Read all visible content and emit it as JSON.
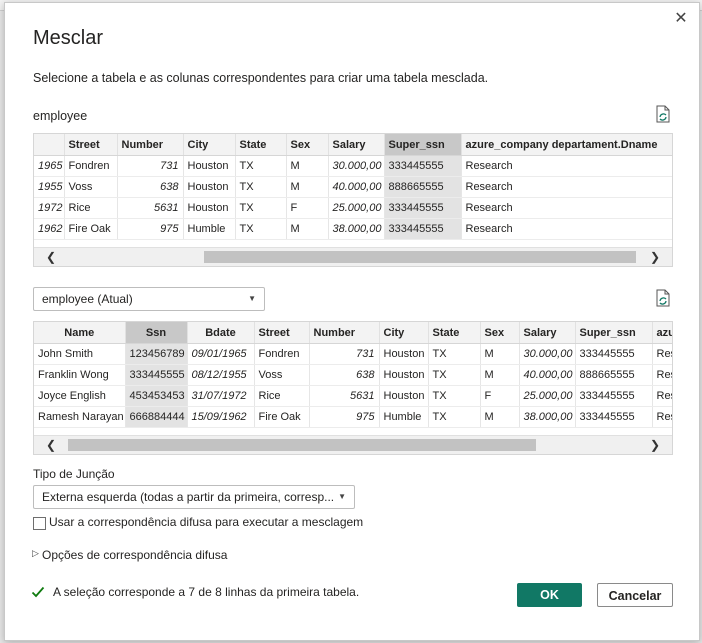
{
  "dialog": {
    "title": "Mesclar",
    "description": "Selecione a tabela e as colunas correspondentes para criar uma tabela mesclada.",
    "close_icon": "close-icon"
  },
  "first_table": {
    "name": "employee",
    "columns": [
      "",
      "Street",
      "Number",
      "City",
      "State",
      "Sex",
      "Salary",
      "Super_ssn",
      "azure_company departament.Dname"
    ],
    "rows": [
      [
        "1965",
        "Fondren",
        "731",
        "Houston",
        "TX",
        "M",
        "30.000,00",
        "333445555",
        "Research"
      ],
      [
        "1955",
        "Voss",
        "638",
        "Houston",
        "TX",
        "M",
        "40.000,00",
        "888665555",
        "Research"
      ],
      [
        "1972",
        "Rice",
        "5631",
        "Houston",
        "TX",
        "F",
        "25.000,00",
        "333445555",
        "Research"
      ],
      [
        "1962",
        "Fire Oak",
        "975",
        "Humble",
        "TX",
        "M",
        "38.000,00",
        "333445555",
        "Research"
      ]
    ]
  },
  "second_table": {
    "selected": "employee (Atual)",
    "columns": [
      "Name",
      "Ssn",
      "Bdate",
      "Street",
      "Number",
      "City",
      "State",
      "Sex",
      "Salary",
      "Super_ssn",
      "azu"
    ],
    "rows": [
      [
        "John Smith",
        "123456789",
        "09/01/1965",
        "Fondren",
        "731",
        "Houston",
        "TX",
        "M",
        "30.000,00",
        "333445555",
        "Res"
      ],
      [
        "Franklin Wong",
        "333445555",
        "08/12/1955",
        "Voss",
        "638",
        "Houston",
        "TX",
        "M",
        "40.000,00",
        "888665555",
        "Res"
      ],
      [
        "Joyce English",
        "453453453",
        "31/07/1972",
        "Rice",
        "5631",
        "Houston",
        "TX",
        "F",
        "25.000,00",
        "333445555",
        "Res"
      ],
      [
        "Ramesh Narayan",
        "666884444",
        "15/09/1962",
        "Fire Oak",
        "975",
        "Humble",
        "TX",
        "M",
        "38.000,00",
        "333445555",
        "Res"
      ]
    ]
  },
  "join": {
    "label": "Tipo de Junção",
    "value": "Externa esquerda (todas a partir da primeira, corresp..."
  },
  "fuzzy": {
    "checkbox_label": "Usar a correspondência difusa para executar a mesclagem",
    "options_label": "Opções de correspondência difusa"
  },
  "status": {
    "text": "A seleção corresponde a 7 de 8 linhas da primeira tabela."
  },
  "buttons": {
    "ok": "OK",
    "cancel": "Cancelar"
  },
  "colors": {
    "accent": "#117865",
    "check": "#0f7b0f"
  }
}
